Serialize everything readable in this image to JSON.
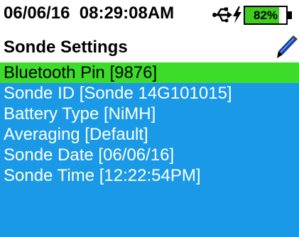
{
  "status": {
    "date": "06/06/16",
    "time": "08:29:08AM",
    "usb_icon": "usb-icon",
    "charging_icon": "lightning-bolt-icon",
    "battery": {
      "label": "82%",
      "level": 0.82,
      "fill_color": "#3ecf1e"
    }
  },
  "header": {
    "title": "Sonde Settings",
    "edit_icon": "pen-icon"
  },
  "menu": {
    "selected_index": 0,
    "items": [
      {
        "label": "Bluetooth Pin [9876]"
      },
      {
        "label": "Sonde ID [Sonde 14G101015]"
      },
      {
        "label": "Battery Type [NiMH]"
      },
      {
        "label": "Averaging [Default]"
      },
      {
        "label": "Sonde Date [06/06/16]"
      },
      {
        "label": "Sonde Time [12:22:54PM]"
      }
    ]
  },
  "colors": {
    "background": "#1a9ae6",
    "selection": "#3ddc2a",
    "header_bg": "#ffffff"
  }
}
